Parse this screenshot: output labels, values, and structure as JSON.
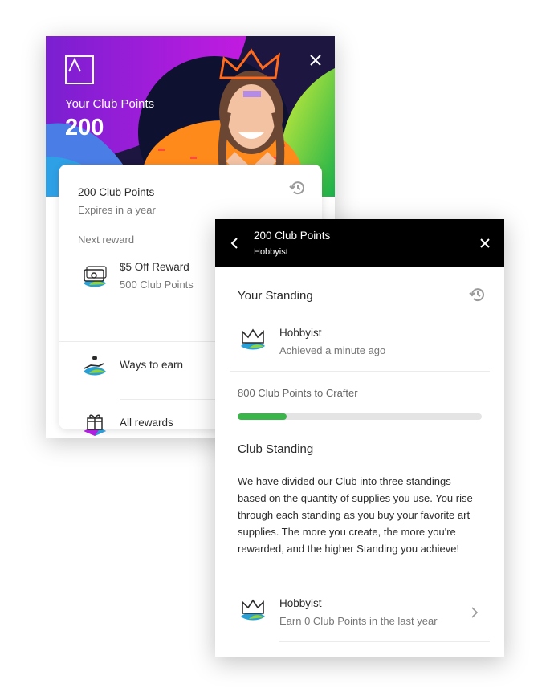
{
  "back_panel": {
    "hero": {
      "label": "Your Club Points",
      "points": "200"
    },
    "summary": {
      "title": "200 Club Points",
      "subtitle": "Expires in a year"
    },
    "next_reward_label": "Next reward",
    "next_reward": {
      "title": "$5 Off Reward",
      "subtitle": "500 Club Points"
    },
    "ways_to_earn": "Ways to earn",
    "all_rewards": "All rewards"
  },
  "front_panel": {
    "header": {
      "title": "200 Club Points",
      "subtitle": "Hobbyist"
    },
    "your_standing": {
      "heading": "Your Standing",
      "tier": "Hobbyist",
      "achieved": "Achieved a minute ago"
    },
    "progress": {
      "label": "800 Club Points to Crafter",
      "fraction": 0.2
    },
    "club_standing": {
      "heading": "Club Standing",
      "body": "We have divided our Club into three standings based on the quantity of supplies you use. You rise through each standing as you buy your favorite art supplies. The more you create, the more you're rewarded, and the higher Standing you achieve!",
      "tier": "Hobbyist",
      "tier_sub": "Earn 0 Club Points in the last year"
    }
  },
  "icons": {
    "logo": "a-logo-icon",
    "close": "close-icon",
    "history": "history-icon",
    "back": "chevron-left-icon",
    "chevron": "chevron-right-icon",
    "money": "money-icon",
    "earn": "hand-coin-icon",
    "gift": "gift-icon",
    "crown": "crown-icon"
  },
  "colors": {
    "progress_fill": "#3ab54a",
    "header_bg": "#000000",
    "accent_purple": "#b01ee0",
    "accent_orange": "#ff8a1c",
    "accent_green": "#8ed43a"
  }
}
